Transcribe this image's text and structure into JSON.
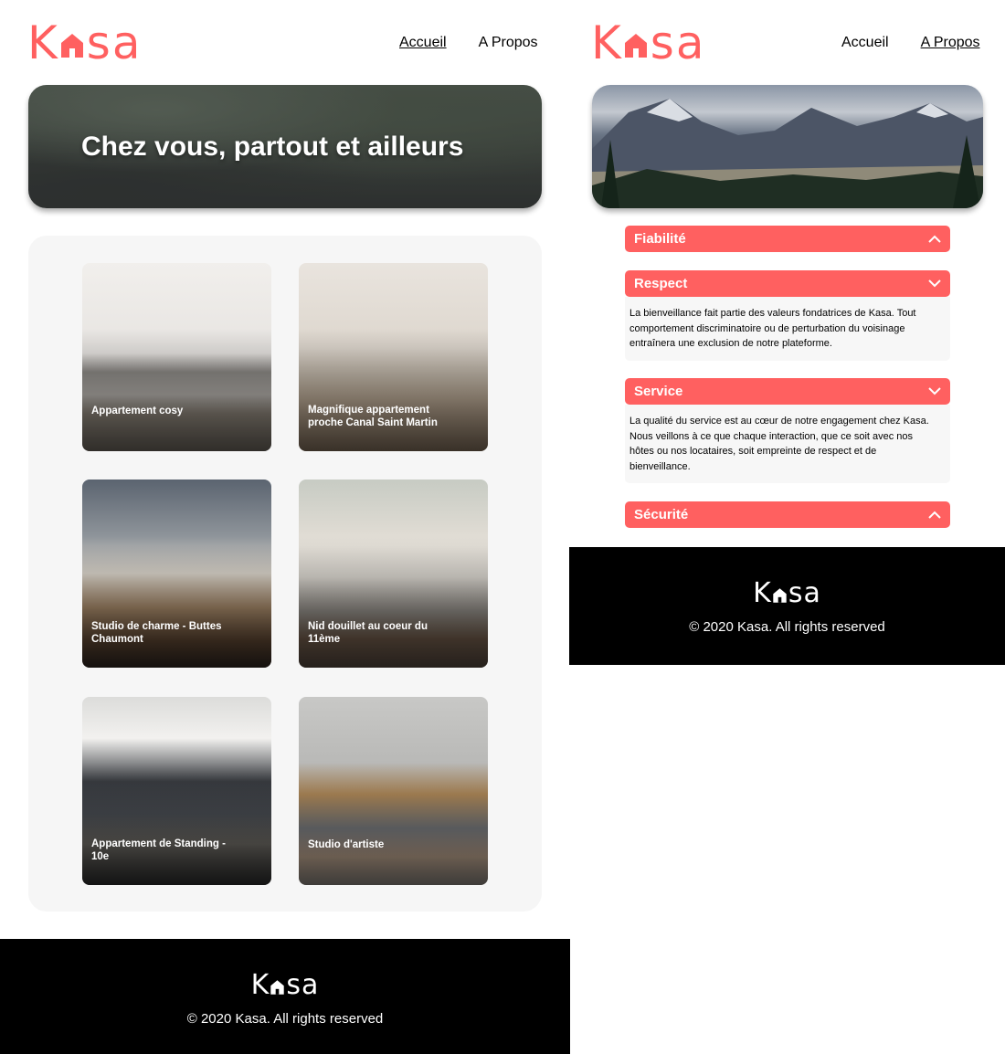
{
  "brand": {
    "name": "Kasa",
    "letters_before": "K",
    "letters_after": "sa",
    "accent_color": "#FF6060",
    "icon": "house-icon"
  },
  "home": {
    "nav": {
      "home_label": "Accueil",
      "about_label": "A Propos"
    },
    "banner": {
      "title": "Chez vous, partout et ailleurs"
    },
    "listings": [
      {
        "title": "Appartement cosy"
      },
      {
        "title": "Magnifique appartement proche Canal Saint Martin"
      },
      {
        "title": "Studio de charme - Buttes Chaumont"
      },
      {
        "title": "Nid douillet au coeur du 11ème"
      },
      {
        "title": "Appartement de Standing - 10e"
      },
      {
        "title": "Studio d'artiste"
      }
    ],
    "footer": {
      "copyright": "© 2020 Kasa. All rights reserved"
    }
  },
  "about": {
    "nav": {
      "home_label": "Accueil",
      "about_label": "A Propos"
    },
    "sections": [
      {
        "title": "Fiabilité",
        "state": "collapsed",
        "chevron": "chevron-up-icon"
      },
      {
        "title": "Respect",
        "state": "expanded",
        "chevron": "chevron-down-icon",
        "text": "La bienveillance fait partie des valeurs fondatrices de Kasa. Tout comportement discriminatoire ou de perturbation du voisinage entraînera une exclusion de notre plateforme."
      },
      {
        "title": "Service",
        "state": "expanded",
        "chevron": "chevron-down-icon",
        "text": "La qualité du service est au cœur de notre engagement chez Kasa. Nous veillons à ce que chaque interaction, que ce soit avec nos hôtes ou nos locataires, soit empreinte de respect et de bienveillance."
      },
      {
        "title": "Sécurité",
        "state": "collapsed",
        "chevron": "chevron-up-icon"
      }
    ],
    "footer": {
      "copyright": "© 2020 Kasa. All rights reserved"
    }
  }
}
